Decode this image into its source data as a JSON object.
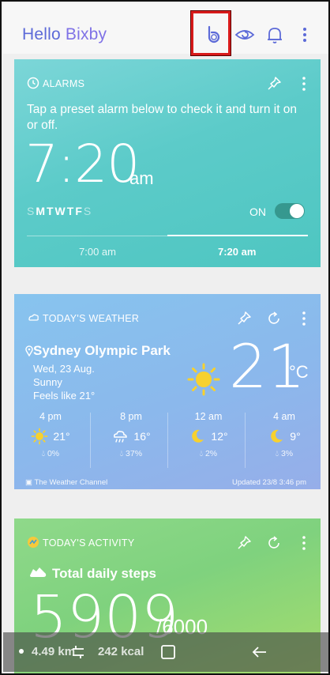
{
  "header": {
    "brand_part1": "Hello ",
    "brand_part2": "Bixby",
    "icons": [
      "bixby-b-icon",
      "eye-icon",
      "bell-icon",
      "more-vertical-icon"
    ]
  },
  "alarm": {
    "title": "ALARMS",
    "description": "Tap a preset alarm below to check it and turn it on or off.",
    "time": "7:20",
    "ampm": "am",
    "days_off_start": "S",
    "days_on": "MTWTF",
    "days_off_end": "S",
    "toggle_label": "ON",
    "toggle_on": true,
    "presets": [
      "7:00 am",
      "7:20 am"
    ],
    "selected_preset": "7:20 am"
  },
  "weather": {
    "title": "TODAY'S WEATHER",
    "location": "Sydney Olympic Park",
    "date": "Wed, 23 Aug.",
    "condition": "Sunny",
    "feels_like": "Feels like 21°",
    "temperature": "21",
    "unit": "°C",
    "forecast": [
      {
        "time": "4 pm",
        "icon": "sun-icon",
        "temp": "21°",
        "rain": "0%"
      },
      {
        "time": "8 pm",
        "icon": "rain-cloud-icon",
        "temp": "16°",
        "rain": "37%"
      },
      {
        "time": "12 am",
        "icon": "moon-icon",
        "temp": "12°",
        "rain": "2%"
      },
      {
        "time": "4 am",
        "icon": "moon-icon",
        "temp": "9°",
        "rain": "3%"
      }
    ],
    "provider": "The Weather Channel",
    "updated": "Updated 23/8 3:46 pm"
  },
  "activity": {
    "title": "TODAY'S ACTIVITY",
    "steps_label": "Total daily steps",
    "steps": "5909",
    "goal": "/6000",
    "distance": "4.49 km",
    "calories": "242 kcal"
  },
  "colors": {
    "brand": "#5c6ad8",
    "alarm_card": "#5ccbc9",
    "weather_card": "#8bb8ec",
    "activity_card": "#8fd98a",
    "highlight": "#d81b1b"
  }
}
